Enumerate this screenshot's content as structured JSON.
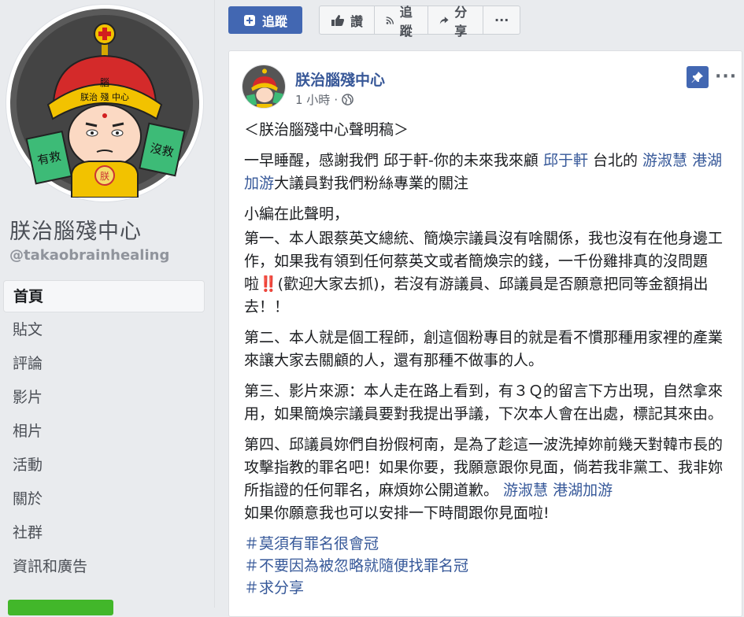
{
  "page": {
    "name": "朕治腦殘中心",
    "handle": "@takaobrainhealing"
  },
  "avatar_text": {
    "hat": "腦",
    "band": "朕治 殘 中心",
    "left_sign": "有救",
    "right_sign": "沒救",
    "shirt": "朕"
  },
  "nav": [
    {
      "label": "首頁",
      "active": true
    },
    {
      "label": "貼文"
    },
    {
      "label": "評論"
    },
    {
      "label": "影片"
    },
    {
      "label": "相片"
    },
    {
      "label": "活動"
    },
    {
      "label": "關於"
    },
    {
      "label": "社群"
    },
    {
      "label": "資訊和廣告"
    }
  ],
  "actionbar": {
    "follow_primary": "追蹤",
    "like": "讚",
    "follow": "追蹤",
    "share": "分享",
    "more": "···"
  },
  "post": {
    "author": "朕治腦殘中心",
    "time": "1 小時",
    "separator": "·",
    "title": "＜朕治腦殘中心聲明稿＞",
    "p1": {
      "t1": "一早睡醒，感謝我們 邱于軒-你的未來我來顧 ",
      "l1": "邱于軒",
      "t2": " 台北的 ",
      "l2": "游淑慧",
      "t3": " ",
      "l3": "港湖加游",
      "t4": "大議員對我們粉絲專業的關注"
    },
    "p2_intro": "小編在此聲明，",
    "p2": "第一、本人跟蔡英文總統、簡煥宗議員沒有啥關係，我也沒有在他身邊工作，如果我有領到任何蔡英文或者簡煥宗的錢，一千份雞排真的沒問題啦‼️(歡迎大家去抓)，若沒有游議員、邱議員是否願意把同等金額捐出去！！",
    "p3": "第二、本人就是個工程師，創這個粉專目的就是看不慣那種用家裡的產業來讓大家去關顧的人，還有那種不做事的人。",
    "p4": "第三、影片來源：本人走在路上看到，有３Ｑ的留言下方出現，自然拿來用，如果簡煥宗議員要對我提出爭議，下次本人會在出處，標記其來由。",
    "p5": {
      "t1": "第四、邱議員妳們自扮假柯南，是為了趁這一波洗掉妳前幾天對韓市長的攻擊指教的罪名吧！如果你要，我願意跟你見面，倘若我非黨工、我非妳所指證的任何罪名，麻煩妳公開道歉。 ",
      "l1": "游淑慧",
      "t2": " ",
      "l2": "港湖加游",
      "t3": "如果你願意我也可以安排一下時間跟你見面啦!"
    },
    "hashtags": [
      "＃莫須有罪名很會冠",
      "＃不要因為被忽略就隨便找罪名冠",
      "＃求分享"
    ]
  },
  "colors": {
    "primary": "#4267b2",
    "link": "#365899",
    "background": "#e9ebee"
  },
  "icons": [
    "plus-icon",
    "thumbs-up-icon",
    "rss-icon",
    "share-arrow-icon",
    "more-icon",
    "globe-icon",
    "pin-icon"
  ]
}
